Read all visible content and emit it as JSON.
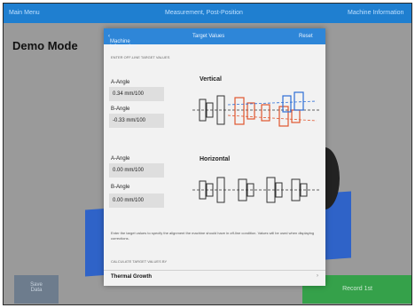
{
  "topbar": {
    "left": "Main Menu",
    "center": "Measurement, Post-Position",
    "right": "Machine Information"
  },
  "page": {
    "mode_title": "Demo Mode",
    "left_button": "Save\nData",
    "right_button": "Record 1st"
  },
  "modal": {
    "back_label": "Machine Information",
    "title": "Target Values",
    "reset_label": "Reset",
    "section_title": "ENTER OFF-LINE TARGET VALUES",
    "vertical": {
      "label": "Vertical",
      "a_label": "A-Angle",
      "a_value": "0.34 mm/100",
      "b_label": "B-Angle",
      "b_value": "-0.33 mm/100"
    },
    "horizontal": {
      "label": "Horizontal",
      "a_label": "A-Angle",
      "a_value": "0.00 mm/100",
      "b_label": "B-Angle",
      "b_value": "0.00 mm/100"
    },
    "note": "Enter the target values to specify the alignment the machine should have in off-line condition. Values will be used when displaying corrections.",
    "calc_title": "CALCULATE TARGET VALUES BY",
    "calc_option": "Thermal Growth"
  },
  "colors": {
    "topbar": "#1f7fd0",
    "accent": "#2e86d8",
    "diagram_red": "#e0562f",
    "diagram_blue": "#2f6fd6",
    "record_green": "#35a14a"
  }
}
